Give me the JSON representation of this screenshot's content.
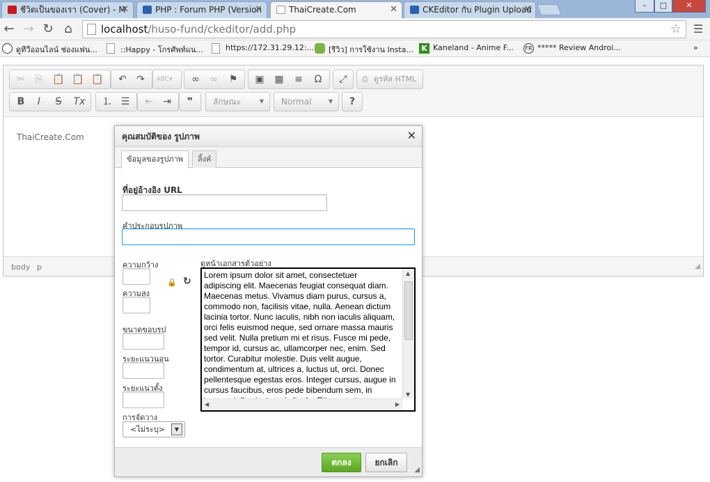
{
  "browser": {
    "tabs": [
      {
        "title": "ชีวิตเป็นของเรา (Cover) - M",
        "icon": "youtube-icon",
        "color": "#cc181e"
      },
      {
        "title": "PHP : Forum PHP (Version",
        "icon": "forum-icon",
        "color": "#2a62b3"
      },
      {
        "title": "ThaiCreate.Com",
        "icon": "page-icon",
        "color": "#ffffff"
      },
      {
        "title": "CKEditor กับ Plugin Upload",
        "icon": "forum-icon",
        "color": "#2a62b3"
      }
    ],
    "window_buttons": {
      "minimize": "–",
      "maximize": "□",
      "close": "✕"
    },
    "url": {
      "host": "localhost",
      "path": "/huso-fund/ckeditor/add.php"
    },
    "bookmarks": [
      {
        "label": "ดูทีวีออนไลน์ ช่องแฟน...",
        "icon": "bookmark-face-icon"
      },
      {
        "label": "::Happy - โกรศัพท์แน...",
        "icon": "page-icon"
      },
      {
        "label": "https://172.31.29.12:...",
        "icon": "page-icon"
      },
      {
        "label": "[รีวิว] การใช้งาน Insta...",
        "icon": "android-icon"
      },
      {
        "label": "Kaneland - Anime F...",
        "icon": "kaneland-icon"
      },
      {
        "label": "***** Review Androi...",
        "icon": "fr-icon"
      }
    ],
    "overflow": "»"
  },
  "editor": {
    "source_label": "ดูรหัส HTML",
    "styles_combo": "ลักษณะ",
    "format_combo": "Normal",
    "help": "?",
    "content_sample": "ThaiCreate.Com",
    "path": [
      "body",
      "p"
    ]
  },
  "dialog": {
    "title": "คุณสมบัติของ รูปภาพ",
    "close": "✕",
    "tabs": [
      "ข้อมูลของรูปภาพ",
      "ลิ้งค์"
    ],
    "url_label": "ที่อยู่อ้างอิง URL",
    "url_value": "",
    "alt_label": "คำประกอบรูปภาพ",
    "alt_value": "",
    "width_label": "ความกว้าง",
    "height_label": "ความสูง",
    "border_label": "ขนาดขอบรูป",
    "hspace_label": "ระยะแนวนอน",
    "vspace_label": "ระยะแนวตั้ง",
    "align_label": "การจัดวาง",
    "align_value": "<ไม่ระบุ>",
    "preview_label": "ดูหน้าเอกสารตัวอย่าง",
    "preview_text": "Lorem ipsum dolor sit amet, consectetuer adipiscing elit. Maecenas feugiat consequat diam. Maecenas metus. Vivamus diam purus, cursus a, commodo non, facilisis vitae, nulla. Aenean dictum lacinia tortor. Nunc iaculis, nibh non iaculis aliquam, orci felis euismod neque, sed ornare massa mauris sed velit. Nulla pretium mi et risus. Fusce mi pede, tempor id, cursus ac, ullamcorper nec, enim. Sed tortor. Curabitur molestie. Duis velit augue, condimentum at, ultrices a, luctus ut, orci. Donec pellentesque egestas eros. Integer cursus, augue in cursus faucibus, eros pede bibendum sem, in tempus tellus justo quis ligula. Etiam eget",
    "ok": "ตกลง",
    "cancel": "ยกเลิก"
  }
}
